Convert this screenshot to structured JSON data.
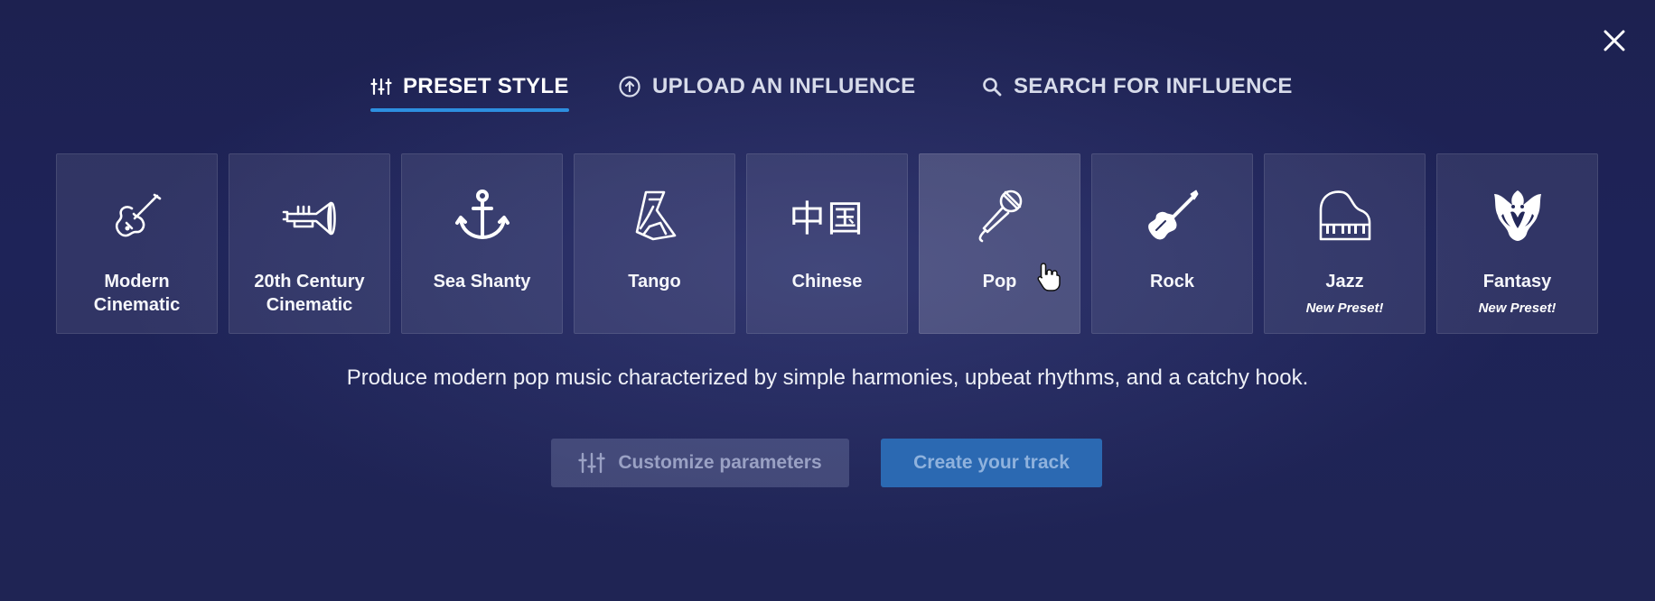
{
  "tabs": [
    {
      "id": "preset",
      "label": "PRESET STYLE",
      "icon": "sliders-icon",
      "active": true
    },
    {
      "id": "upload",
      "label": "UPLOAD AN INFLUENCE",
      "icon": "upload-circle-icon",
      "active": false
    },
    {
      "id": "search",
      "label": "SEARCH FOR INFLUENCE",
      "icon": "search-icon",
      "active": false
    }
  ],
  "presets": [
    {
      "label": "Modern\nCinematic",
      "icon": "violin-icon",
      "badge": ""
    },
    {
      "label": "20th Century\nCinematic",
      "icon": "trumpet-icon",
      "badge": ""
    },
    {
      "label": "Sea Shanty",
      "icon": "anchor-icon",
      "badge": ""
    },
    {
      "label": "Tango",
      "icon": "bandoneon-icon",
      "badge": ""
    },
    {
      "label": "Chinese",
      "icon": "chinese-characters-icon",
      "glyph": "中国",
      "badge": ""
    },
    {
      "label": "Pop",
      "icon": "microphone-icon",
      "badge": "",
      "hovered": true
    },
    {
      "label": "Rock",
      "icon": "electric-guitar-icon",
      "badge": ""
    },
    {
      "label": "Jazz",
      "icon": "grand-piano-icon",
      "badge": "New Preset!"
    },
    {
      "label": "Fantasy",
      "icon": "dragon-icon",
      "badge": "New Preset!"
    }
  ],
  "description": "Produce modern pop music characterized by simple harmonies, upbeat rhythms, and a catchy hook.",
  "actions": {
    "customize_label": "Customize parameters",
    "create_label": "Create your track"
  },
  "colors": {
    "accent": "#2d8fe0",
    "create_button": "#2b69b2",
    "background": "#1e2358"
  }
}
